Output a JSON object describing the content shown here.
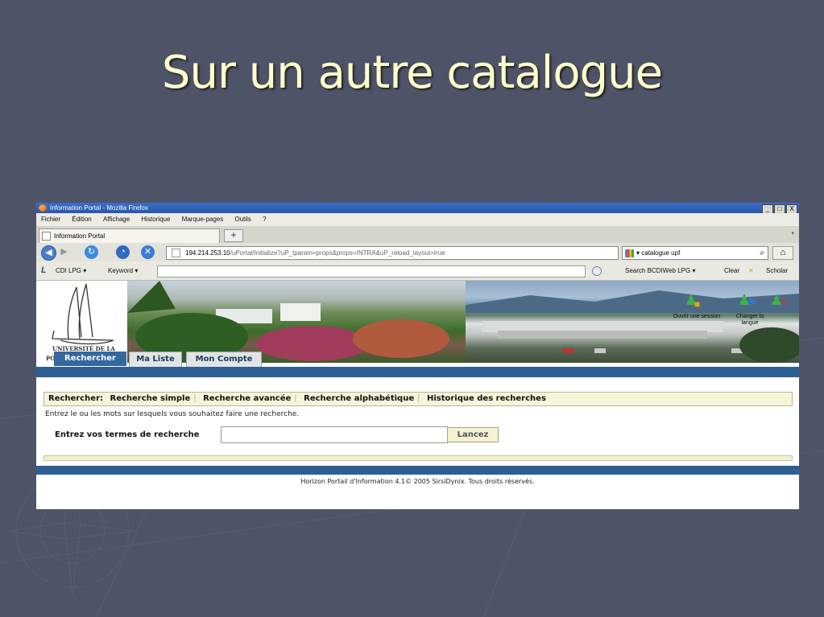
{
  "slide": {
    "title": "Sur un autre catalogue"
  },
  "browser": {
    "window_title": "Information Portal - Mozilla Firefox",
    "window_buttons": [
      "_",
      "□",
      "X"
    ],
    "menu": [
      "Fichier",
      "Édition",
      "Affichage",
      "Historique",
      "Marque-pages",
      "Outils",
      "?"
    ],
    "tab_title": "Information Portal",
    "new_tab": "+",
    "url_host": "194.214.253.10",
    "url_path": "/uPortal/Initialize?uP_tparam=props&props=INTRA&uP_reload_layout=true",
    "url_controls": "▾ C",
    "search_value": "catalogue upf",
    "toolbar": {
      "cdi": "CDI LPG ▾",
      "keyword": "Keyword ▾",
      "search_bcdi": "Search BCDIWeb LPG ▾",
      "clear": "Clear",
      "scholar": "Scholar"
    }
  },
  "portal": {
    "logo_text": "UNIVERSITÉ DE LA",
    "logo_text2": "PO",
    "nav_tabs": [
      "Rechercher",
      "Ma Liste",
      "Mon Compte"
    ],
    "session": {
      "open": "Ouvrir une session",
      "lang": "Changer la langue"
    },
    "search_bar": {
      "label": "Rechercher:",
      "items": [
        "Recherche simple",
        "Recherche avancée",
        "Recherche alphabétique",
        "Historique des recherches"
      ]
    },
    "hint": "Entrez le ou les mots sur lesquels vous souhaitez faire une recherche.",
    "term_label": "Entrez vos termes de recherche",
    "term_value": "",
    "submit_label": "Lancez",
    "footer": "Horizon Portail d'Information 4.1© 2005 SirsiDynix. Tous droits réservés."
  }
}
